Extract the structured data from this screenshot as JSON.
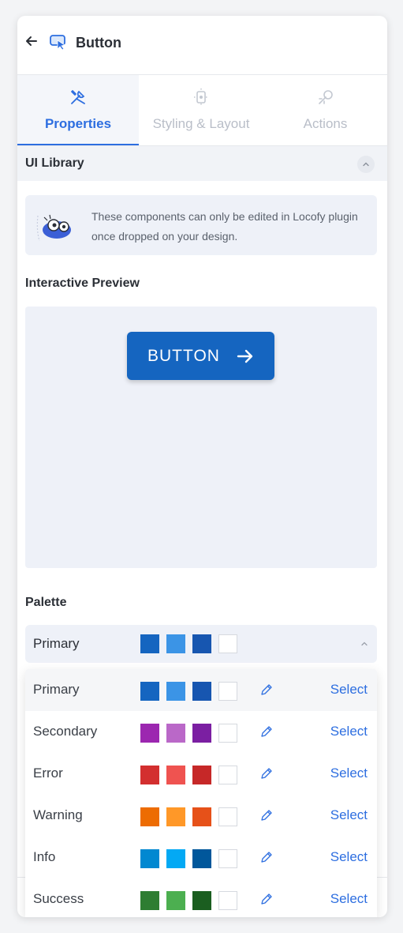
{
  "header": {
    "title": "Button"
  },
  "tabs": [
    {
      "label": "Properties",
      "icon": "tools-icon"
    },
    {
      "label": "Styling & Layout",
      "icon": "layout-icon"
    },
    {
      "label": "Actions",
      "icon": "actions-icon"
    }
  ],
  "ui_library": {
    "title": "UI Library",
    "info_text": "These components can only be edited in Locofy plugin once dropped on your design."
  },
  "preview": {
    "title": "Interactive Preview",
    "button_label": "BUTTON",
    "button_color": "#1565c0"
  },
  "palette": {
    "title": "Palette",
    "selected": "Primary",
    "selected_colors": [
      "#1565c0",
      "#3b94e6",
      "#1756b0",
      "#ffffff"
    ],
    "options": [
      {
        "label": "Primary",
        "colors": [
          "#1565c0",
          "#3b94e6",
          "#1756b0",
          "#ffffff"
        ],
        "action": "Select"
      },
      {
        "label": "Secondary",
        "colors": [
          "#9c27b0",
          "#ba68c8",
          "#7b1fa2",
          "#ffffff"
        ],
        "action": "Select"
      },
      {
        "label": "Error",
        "colors": [
          "#d32f2f",
          "#ef5350",
          "#c62828",
          "#ffffff"
        ],
        "action": "Select"
      },
      {
        "label": "Warning",
        "colors": [
          "#ed6c02",
          "#ff9828",
          "#e65119",
          "#ffffff"
        ],
        "action": "Select"
      },
      {
        "label": "Info",
        "colors": [
          "#0288d1",
          "#03a9f4",
          "#01579b",
          "#ffffff"
        ],
        "action": "Select"
      },
      {
        "label": "Success",
        "colors": [
          "#2e7d32",
          "#4caf50",
          "#1b5e20",
          "#ffffff"
        ],
        "action": "Select"
      }
    ]
  },
  "accent_color": "#2d6ee0"
}
